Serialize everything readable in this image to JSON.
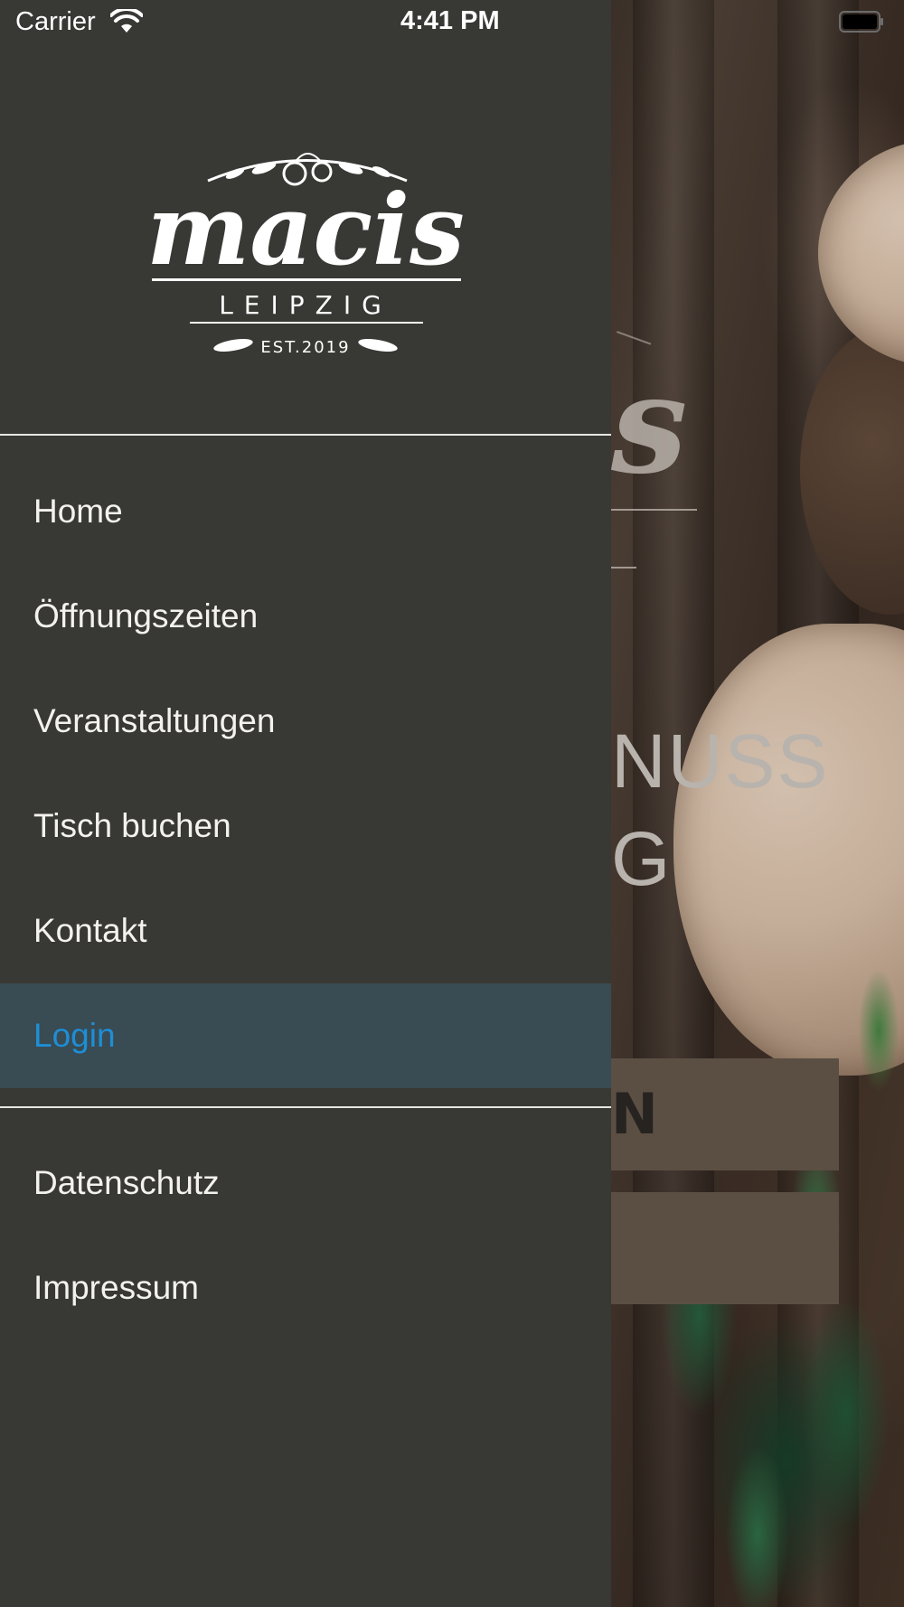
{
  "status_bar": {
    "carrier": "Carrier",
    "time": "4:41 PM",
    "wifi_icon": "wifi-icon",
    "battery_icon": "battery-icon"
  },
  "drawer": {
    "logo": {
      "name": "macis",
      "city": "LEIPZIG",
      "established": "EST.2019"
    },
    "main_items": [
      {
        "label": "Home",
        "active": false
      },
      {
        "label": "Öffnungszeiten",
        "active": false
      },
      {
        "label": "Veranstaltungen",
        "active": false
      },
      {
        "label": "Tisch buchen",
        "active": false
      },
      {
        "label": "Kontakt",
        "active": false
      },
      {
        "label": "Login",
        "active": true
      }
    ],
    "secondary_items": [
      {
        "label": "Datenschutz"
      },
      {
        "label": "Impressum"
      }
    ],
    "active_color": "#1e8ed6",
    "background_color": "#383834"
  },
  "background_page": {
    "logo_fragment": "s",
    "tagline_line1": "NUSS",
    "tagline_line2": "G",
    "button1_fragment": "N",
    "button_color": "#5b4f44"
  }
}
